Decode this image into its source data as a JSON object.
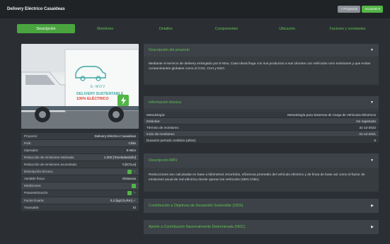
{
  "header": {
    "title": "Delivery Eléctrico Casaideas",
    "btn_projects": "< Proyectos",
    "btn_actions": "Acciones ▾"
  },
  "tabs": [
    "Descripción",
    "Monitoreo",
    "Detalles",
    "Componentes",
    "Ubicación",
    "Factores y constantes"
  ],
  "photo": {
    "brand": "E-MOV",
    "line1": "DELIVERY SUSTENTABLE",
    "line2": "100% ELÉCTRICO"
  },
  "project_info": [
    {
      "k": "Proyecto:",
      "v": "Delivery Eléctrico Casaideas"
    },
    {
      "k": "País:",
      "v": "Chile"
    },
    {
      "k": "Operador:",
      "v": "E-Mov"
    },
    {
      "k": "Reducción de emisiones estimada:",
      "v": "1.000 [Toneladas/año]"
    },
    {
      "k": "Reducción de emisiones acumulada:",
      "v": "0 [tCO₂e]"
    },
    {
      "k": "Descripción técnica:",
      "v": ""
    },
    {
      "k": "Variable física:",
      "v": "Distancia"
    },
    {
      "k": "Mediciones:",
      "v": ""
    },
    {
      "k": "Parametrización:",
      "v": ""
    },
    {
      "k": "Factor Evarte:",
      "v": "0,2 [kgCO₂/km] ✓"
    },
    {
      "k": "Transable:",
      "v": "Sí"
    }
  ],
  "desc_card": {
    "title": "Descripción del proyecto",
    "text": "Mediante el servicio de delivery entregado por E-Mov, Casa Ideas llega con sus productos a sus clientes con vehículos cero emisiones y que evitan contaminantes globales como el CO2, CH4 y N2O."
  },
  "tech_card": {
    "title": "Información técnica",
    "rows": [
      {
        "k": "Metodología:",
        "v": "Metodología para Sistemas de Carga de Vehículos Eléctricos"
      },
      {
        "k": "Estándar:",
        "v": "No registrado"
      },
      {
        "k": "Término de monitoreo:",
        "v": "31-12-2022"
      },
      {
        "k": "Inicio de monitoreo:",
        "v": "01-12-2021"
      },
      {
        "k": "Duración período crediticio (años):",
        "v": "5"
      }
    ]
  },
  "mrv_card": {
    "title": "Descripción MRV",
    "text": "Reducciones son calculadas en base a kilómetros recorridos, eficiencia promedio del vehículo eléctrico y de línea de base así como el factor de emisiones anual de red eléctrica donde operan los vehículos (SEN Chile)."
  },
  "ods_card": {
    "title": "Contribución a Objetivos de Desarrollo Sostenible (ODS)"
  },
  "ndc_card": {
    "title": "Aporte a Contribución Nacionalmente Determinada (NDC)"
  },
  "colors": {
    "accent": "#53b548",
    "bg": "#2b2f33",
    "panel": "#373c41"
  }
}
